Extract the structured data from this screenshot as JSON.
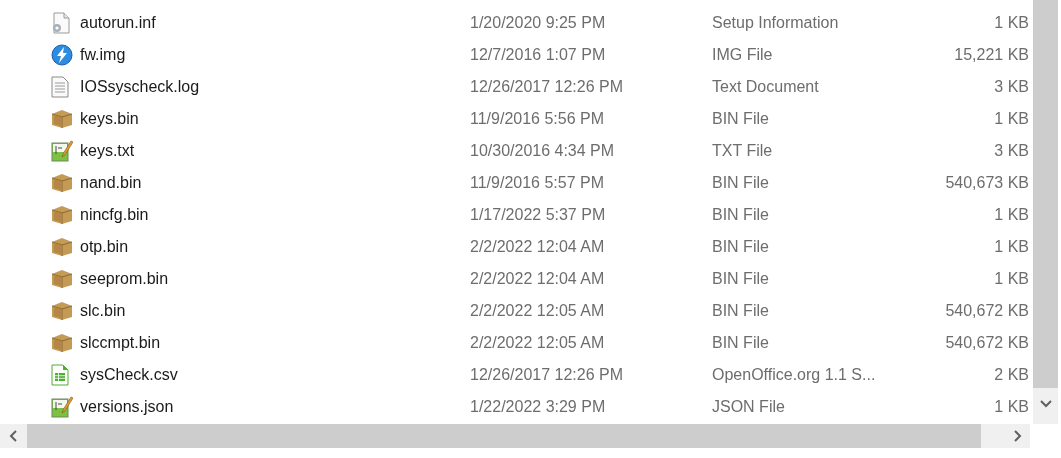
{
  "files": [
    {
      "kind": "settings",
      "name": "autorun.inf",
      "modified": "1/20/2020 9:25 PM",
      "type": "Setup Information",
      "size": "1 KB"
    },
    {
      "kind": "disc",
      "name": "fw.img",
      "modified": "12/7/2016 1:07 PM",
      "type": "IMG File",
      "size": "15,221 KB"
    },
    {
      "kind": "text",
      "name": "IOSsyscheck.log",
      "modified": "12/26/2017 12:26 PM",
      "type": "Text Document",
      "size": "3 KB"
    },
    {
      "kind": "package",
      "name": "keys.bin",
      "modified": "11/9/2016 5:56 PM",
      "type": "BIN File",
      "size": "1 KB"
    },
    {
      "kind": "editor",
      "name": "keys.txt",
      "modified": "10/30/2016 4:34 PM",
      "type": "TXT File",
      "size": "3 KB"
    },
    {
      "kind": "package",
      "name": "nand.bin",
      "modified": "11/9/2016 5:57 PM",
      "type": "BIN File",
      "size": "540,673 KB"
    },
    {
      "kind": "package",
      "name": "nincfg.bin",
      "modified": "1/17/2022 5:37 PM",
      "type": "BIN File",
      "size": "1 KB"
    },
    {
      "kind": "package",
      "name": "otp.bin",
      "modified": "2/2/2022 12:04 AM",
      "type": "BIN File",
      "size": "1 KB"
    },
    {
      "kind": "package",
      "name": "seeprom.bin",
      "modified": "2/2/2022 12:04 AM",
      "type": "BIN File",
      "size": "1 KB"
    },
    {
      "kind": "package",
      "name": "slc.bin",
      "modified": "2/2/2022 12:05 AM",
      "type": "BIN File",
      "size": "540,672 KB"
    },
    {
      "kind": "package",
      "name": "slccmpt.bin",
      "modified": "2/2/2022 12:05 AM",
      "type": "BIN File",
      "size": "540,672 KB"
    },
    {
      "kind": "spreadsheet",
      "name": "sysCheck.csv",
      "modified": "12/26/2017 12:26 PM",
      "type": "OpenOffice.org 1.1 S...",
      "size": "2 KB"
    },
    {
      "kind": "editor",
      "name": "versions.json",
      "modified": "1/22/2022 3:29 PM",
      "type": "JSON File",
      "size": "1 KB"
    }
  ]
}
